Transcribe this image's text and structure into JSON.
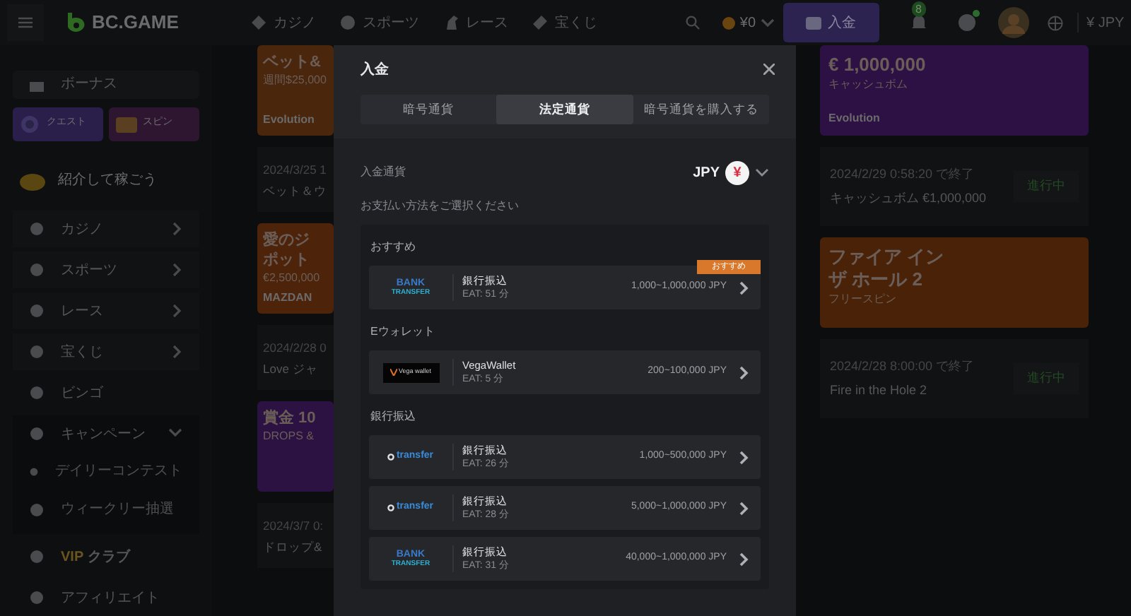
{
  "header": {
    "logo": "BC.GAME",
    "nav": [
      {
        "label": "カジノ"
      },
      {
        "label": "スポーツ"
      },
      {
        "label": "レース"
      },
      {
        "label": "宝くじ"
      }
    ],
    "balance": "¥0",
    "deposit_button": "入金",
    "notification_count": "8",
    "currency": "¥ JPY"
  },
  "sidebar": {
    "bonus": "ボーナス",
    "tiles": [
      {
        "label": "クエスト",
        "color": "#2a1f4a"
      },
      {
        "label": "スピン",
        "color": "#2e1630"
      }
    ],
    "referral": "紹介して稼ごう",
    "items": [
      {
        "label": "カジノ",
        "kind": "link"
      },
      {
        "label": "スポーツ",
        "kind": "link"
      },
      {
        "label": "レース",
        "kind": "link"
      },
      {
        "label": "宝くじ",
        "kind": "link"
      },
      {
        "label": "ビンゴ",
        "kind": "plain"
      },
      {
        "label": "キャンペーン",
        "kind": "group",
        "expanded": true,
        "children": [
          {
            "label": "デイリーコンテスト"
          },
          {
            "label": "ウィークリー抽選"
          }
        ]
      },
      {
        "label": "クラブ",
        "badge": "VIP",
        "kind": "vip"
      },
      {
        "label": "アフィリエイト",
        "kind": "plain"
      }
    ]
  },
  "promotions_left": [
    {
      "banner": {
        "title": [
          "ベット&"
        ],
        "subtitle": "週間$25,000",
        "provider": "Evolution",
        "color": "#4a260c"
      },
      "date": "2024/3/25 1",
      "name": "ベット＆ウ"
    },
    {
      "banner": {
        "title": [
          "愛のジ",
          "ポット"
        ],
        "subtitle": "€2,500,000",
        "provider": "MAZDAN",
        "color": "#4d240a"
      },
      "date": "2024/2/28 0",
      "name": "Love ジャ"
    },
    {
      "banner": {
        "title": [
          "賞金 10"
        ],
        "subtitle": "DROPS &",
        "color": "#2b1242"
      },
      "date": "2024/3/7 0:",
      "name": "ドロップ&"
    }
  ],
  "promotions_right": [
    {
      "banner": {
        "title": [
          "€ 1,000,000"
        ],
        "subtitle": "キャッシュボム",
        "provider": "Evolution",
        "color": "#2d1145"
      },
      "date": "2024/2/29 0:58:20 で終了",
      "name": "キャッシュボム €1,000,000",
      "status": "進行中"
    },
    {
      "banner": {
        "title": [
          "ファイア イン",
          "ザ ホール 2"
        ],
        "subtitle": "フリースピン",
        "color": "#4a2208"
      },
      "date": "2024/2/28 8:00:00 で終了",
      "name": "Fire in the Hole 2",
      "status": "進行中"
    }
  ],
  "modal": {
    "title": "入金",
    "tabs": [
      {
        "label": "暗号通貨",
        "selected": false
      },
      {
        "label": "法定通貨",
        "selected": true
      },
      {
        "label": "暗号通貨を購入する",
        "selected": false
      }
    ],
    "currency_label": "入金通貨",
    "currency": "JPY",
    "currency_symbol": "¥",
    "prompt": "お支払い方法をご選択ください",
    "groups": [
      {
        "heading": "おすすめ",
        "methods": [
          {
            "logo": {
              "kind": "bank",
              "lines": [
                "BANK",
                "TRANSFER"
              ]
            },
            "name": "銀行振込",
            "eat": "EAT: 51 分",
            "range": "1,000~1,000,000 JPY",
            "badge": "おすすめ"
          }
        ]
      },
      {
        "heading": "Eウォレット",
        "methods": [
          {
            "logo": {
              "kind": "vega",
              "lines": [
                "Vega wallet"
              ]
            },
            "name": "VegaWallet",
            "eat": "EAT: 5 分",
            "range": "200~100,000 JPY"
          }
        ]
      },
      {
        "heading": "銀行振込",
        "methods": [
          {
            "logo": {
              "kind": "transfer",
              "lines": [
                "transfer"
              ]
            },
            "name": "銀行振込",
            "eat": "EAT: 26 分",
            "range": "1,000~500,000 JPY"
          },
          {
            "logo": {
              "kind": "transfer",
              "lines": [
                "transfer"
              ]
            },
            "name": "銀行振込",
            "eat": "EAT: 28 分",
            "range": "5,000~1,000,000 JPY"
          },
          {
            "logo": {
              "kind": "bank",
              "lines": [
                "BANK",
                "TRANSFER"
              ]
            },
            "name": "銀行振込",
            "eat": "EAT: 31 分",
            "range": "40,000~1,000,000 JPY"
          }
        ]
      }
    ]
  }
}
